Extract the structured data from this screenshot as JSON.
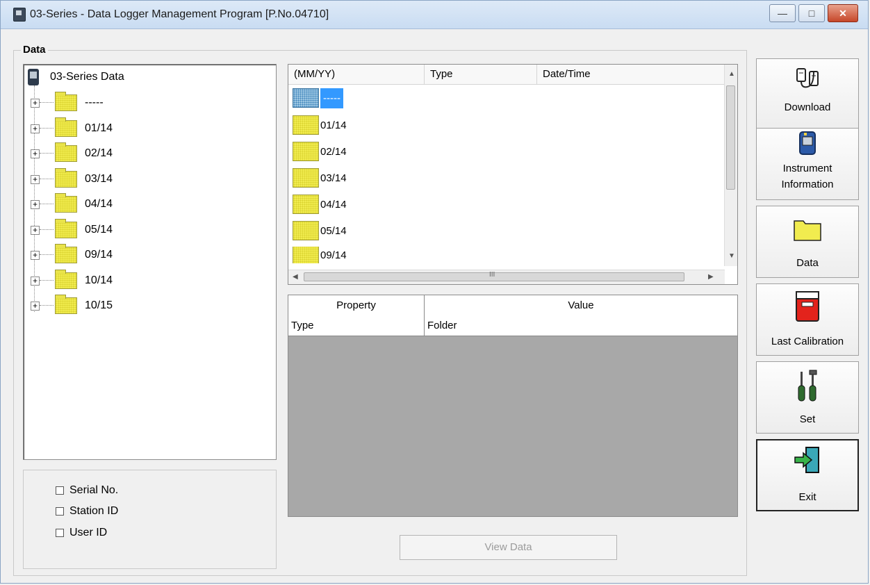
{
  "window": {
    "title": "03-Series  - Data Logger Management Program [P.No.04710]"
  },
  "group": {
    "label": "Data"
  },
  "tree": {
    "root_label": "03-Series Data",
    "items": [
      "-----",
      "01/14",
      "02/14",
      "03/14",
      "04/14",
      "05/14",
      "09/14",
      "10/14",
      "10/15"
    ]
  },
  "filters": {
    "serial": "Serial No.",
    "station": "Station ID",
    "user": "User ID"
  },
  "listview": {
    "columns": [
      "(MM/YY)",
      "Type",
      "Date/Time"
    ],
    "items": [
      "-----",
      "01/14",
      "02/14",
      "03/14",
      "04/14",
      "05/14",
      "09/14"
    ],
    "hscroll_grip": "III"
  },
  "properties": {
    "columns": [
      "Property",
      "Value"
    ],
    "rows": [
      {
        "property": "Type",
        "value": "Folder"
      }
    ]
  },
  "view_button": "View Data",
  "sidebar": {
    "download": "Download",
    "instrument_line1": "Instrument",
    "instrument_line2": "Information",
    "data": "Data",
    "calibration": "Last Calibration",
    "set": "Set",
    "exit": "Exit"
  }
}
